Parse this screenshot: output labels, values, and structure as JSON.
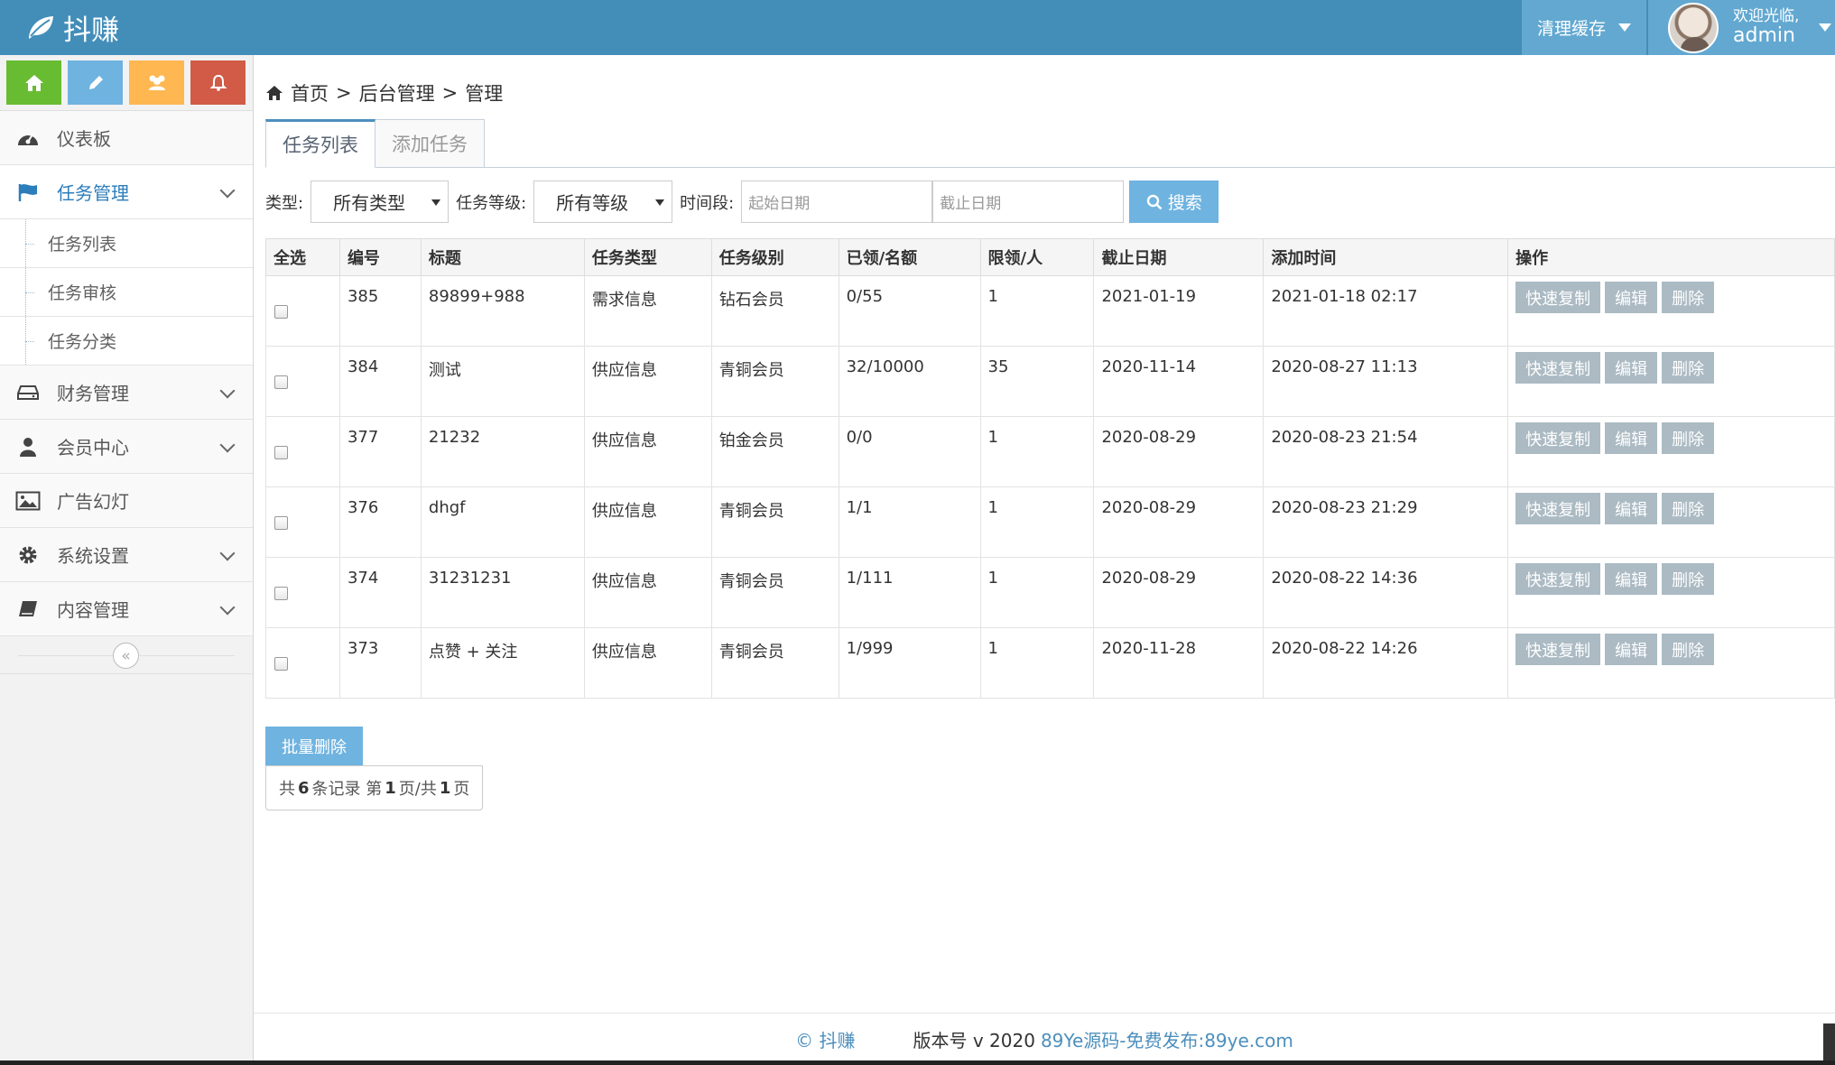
{
  "app": {
    "title": "抖赚"
  },
  "header": {
    "cache_label": "清理缓存",
    "welcome": "欢迎光临,",
    "username": "admin"
  },
  "sidebar": {
    "shortcuts": [
      {
        "icon": "home-icon",
        "color": "#68bc31"
      },
      {
        "icon": "pencil-icon",
        "color": "#6fb3e0"
      },
      {
        "icon": "users-icon",
        "color": "#ffb752"
      },
      {
        "icon": "bell-icon",
        "color": "#d15b47"
      }
    ],
    "items": [
      {
        "label": "仪表板",
        "icon": "dashboard-icon"
      },
      {
        "label": "任务管理",
        "icon": "flag-icon",
        "active": true,
        "children": [
          "任务列表",
          "任务审核",
          "任务分类"
        ]
      },
      {
        "label": "财务管理",
        "icon": "drive-icon"
      },
      {
        "label": "会员中心",
        "icon": "user-icon"
      },
      {
        "label": "广告幻灯",
        "icon": "picture-icon"
      },
      {
        "label": "系统设置",
        "icon": "cog-icon"
      },
      {
        "label": "内容管理",
        "icon": "book-icon"
      }
    ],
    "collapse_glyph": "«"
  },
  "breadcrumb": {
    "home": "首页",
    "sep1": ">",
    "section": "后台管理",
    "sep2": ">",
    "page": "管理"
  },
  "tabs": [
    "任务列表",
    "添加任务"
  ],
  "filters": {
    "type_label": "类型:",
    "type_value": "所有类型",
    "level_label": "任务等级:",
    "level_value": "所有等级",
    "time_label": "时间段:",
    "start_placeholder": "起始日期",
    "end_placeholder": "截止日期",
    "search_label": "搜索"
  },
  "table": {
    "headers": [
      "全选",
      "编号",
      "标题",
      "任务类型",
      "任务级别",
      "已领/名额",
      "限领/人",
      "截止日期",
      "添加时间",
      "操作"
    ],
    "actions": [
      "快速复制",
      "编辑",
      "删除"
    ],
    "rows": [
      [
        "385",
        "89899+988",
        "需求信息",
        "钻石会员",
        "0/55",
        "1",
        "2021-01-19",
        "2021-01-18 02:17"
      ],
      [
        "384",
        "测试",
        "供应信息",
        "青铜会员",
        "32/10000",
        "35",
        "2020-11-14",
        "2020-08-27 11:13"
      ],
      [
        "377",
        "21232",
        "供应信息",
        "铂金会员",
        "0/0",
        "1",
        "2020-08-29",
        "2020-08-23 21:54"
      ],
      [
        "376",
        "dhgf",
        "供应信息",
        "青铜会员",
        "1/1",
        "1",
        "2020-08-29",
        "2020-08-23 21:29"
      ],
      [
        "374",
        "31231231",
        "供应信息",
        "青铜会员",
        "1/111",
        "1",
        "2020-08-29",
        "2020-08-22 14:36"
      ],
      [
        "373",
        "点赞 + 关注",
        "供应信息",
        "青铜会员",
        "1/999",
        "1",
        "2020-11-28",
        "2020-08-22 14:26"
      ]
    ]
  },
  "batch_delete": "批量删除",
  "pager": {
    "t1": "共",
    "total": "6",
    "t2": "条记录 第",
    "page": "1",
    "t3": "页/共",
    "pages": "1",
    "t4": "页"
  },
  "footer": {
    "brand": "© 抖赚",
    "version": "版本号 v 2020",
    "link": "89Ye源码-免费发布:89ye.com"
  }
}
